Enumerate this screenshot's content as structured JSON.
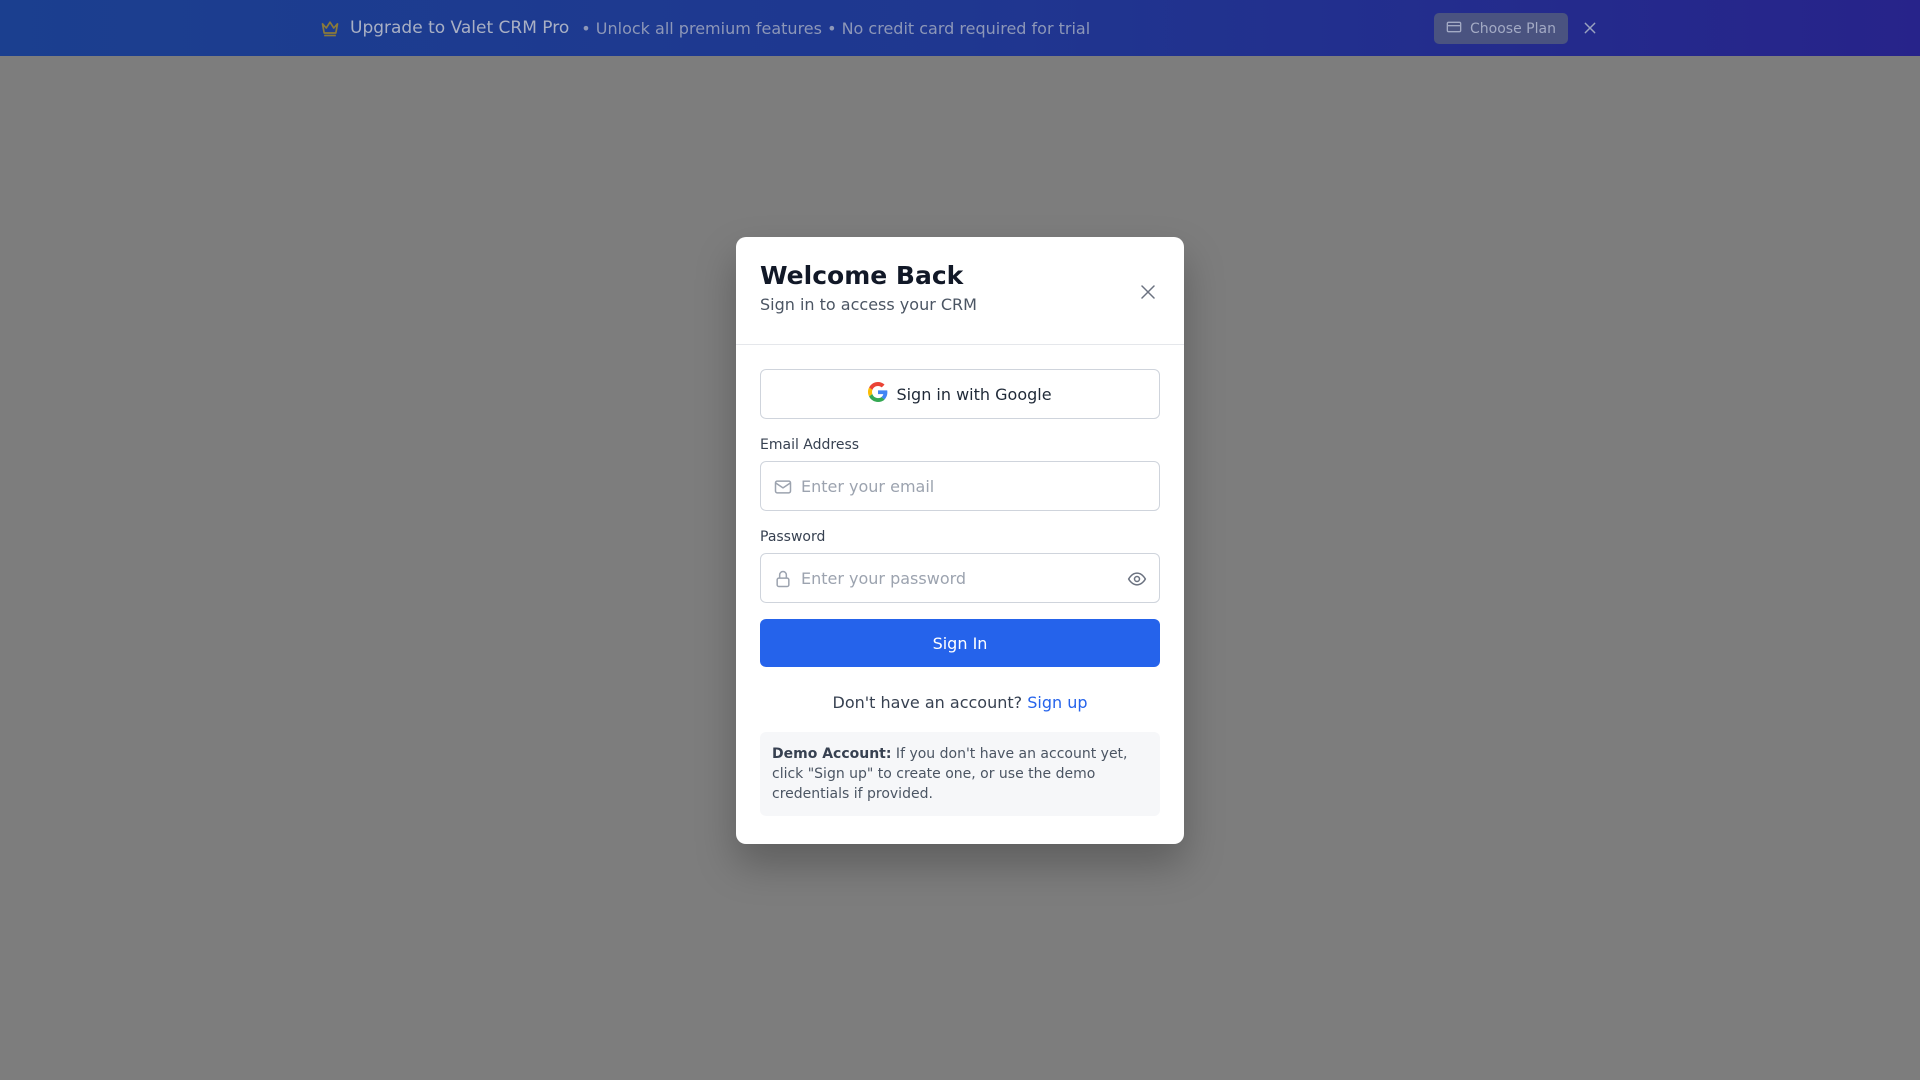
{
  "banner": {
    "title": "Upgrade to Valet CRM Pro",
    "subtitle": "• Unlock all premium features • No credit card required for trial",
    "choose_plan_label": "Choose Plan",
    "icons": {
      "crown": "crown-icon",
      "card": "credit-card-icon",
      "close": "close-icon"
    }
  },
  "modal": {
    "title": "Welcome Back",
    "subtitle": "Sign in to access your CRM",
    "google_label": "Sign in with Google",
    "email": {
      "label": "Email Address",
      "placeholder": "Enter your email",
      "value": ""
    },
    "password": {
      "label": "Password",
      "placeholder": "Enter your password",
      "value": ""
    },
    "signin_label": "Sign In",
    "signup_prompt": "Don't have an account?",
    "signup_link": "Sign up",
    "demo": {
      "strong": "Demo Account:",
      "text": " If you don't have an account yet, click \"Sign up\" to create one, or use the demo credentials if provided."
    }
  },
  "colors": {
    "primary": "#2563eb",
    "banner_start": "#1b3f8f",
    "banner_end": "#27238a",
    "backdrop": "#7d7d7d"
  }
}
